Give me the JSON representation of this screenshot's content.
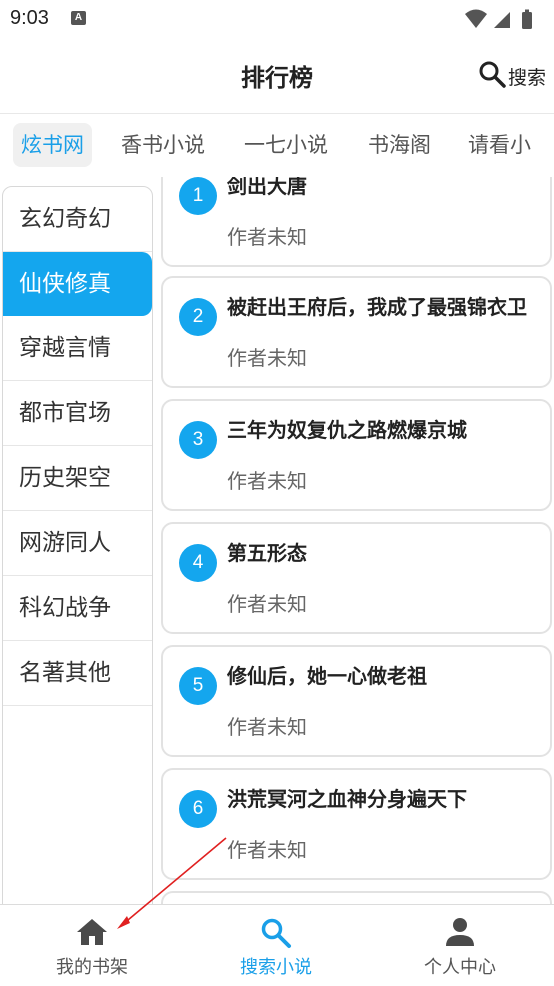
{
  "status": {
    "time": "9:03",
    "notif_glyph": "A"
  },
  "header": {
    "title": "排行榜",
    "search_label": "搜索"
  },
  "tabs": [
    {
      "label": "炫书网",
      "active": true
    },
    {
      "label": "香书小说",
      "active": false
    },
    {
      "label": "一七小说",
      "active": false
    },
    {
      "label": "书海阁",
      "active": false
    },
    {
      "label": "请看小",
      "active": false
    }
  ],
  "categories": [
    {
      "label": "玄幻奇幻",
      "active": false
    },
    {
      "label": "仙侠修真",
      "active": true
    },
    {
      "label": "穿越言情",
      "active": false
    },
    {
      "label": "都市官场",
      "active": false
    },
    {
      "label": "历史架空",
      "active": false
    },
    {
      "label": "网游同人",
      "active": false
    },
    {
      "label": "科幻战争",
      "active": false
    },
    {
      "label": "名著其他",
      "active": false
    }
  ],
  "books": [
    {
      "rank": "1",
      "title": "剑出大唐",
      "author": "作者未知"
    },
    {
      "rank": "2",
      "title": "被赶出王府后，我成了最强锦衣卫",
      "author": "作者未知"
    },
    {
      "rank": "3",
      "title": "三年为奴复仇之路燃爆京城",
      "author": "作者未知"
    },
    {
      "rank": "4",
      "title": "第五形态",
      "author": "作者未知"
    },
    {
      "rank": "5",
      "title": "修仙后，她一心做老祖",
      "author": "作者未知"
    },
    {
      "rank": "6",
      "title": "洪荒冥河之血神分身遍天下",
      "author": "作者未知"
    }
  ],
  "bottom_nav": [
    {
      "label": "我的书架",
      "icon": "home-icon",
      "active": false
    },
    {
      "label": "搜索小说",
      "icon": "search-icon",
      "active": true
    },
    {
      "label": "个人中心",
      "icon": "person-icon",
      "active": false
    }
  ],
  "colors": {
    "accent": "#14a6ee",
    "active_text": "#1a9fe8",
    "annotation": "#e02020"
  }
}
